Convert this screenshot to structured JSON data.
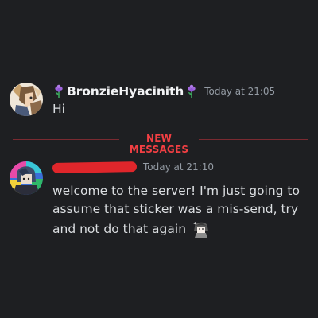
{
  "messages": [
    {
      "username": "BronzieHyacinith",
      "username_color": "#f2f3f5",
      "timestamp": "Today at 21:05",
      "text": "Hi",
      "icon_left": "hyacinth-flower-icon",
      "icon_right": "hyacinth-flower-icon"
    },
    {
      "username_redacted": true,
      "timestamp": "Today at 21:10",
      "text": "welcome to the server! I'm just going to assume that sticker was a mis-send, try and not do that again",
      "emoji": "anime-character-emoji"
    }
  ],
  "divider": {
    "label": "NEW MESSAGES",
    "color": "#f23f43"
  },
  "colors": {
    "background": "#1e1f22",
    "text": "#dbdee1",
    "timestamp": "#949ba4",
    "redaction": "#e0262b"
  }
}
